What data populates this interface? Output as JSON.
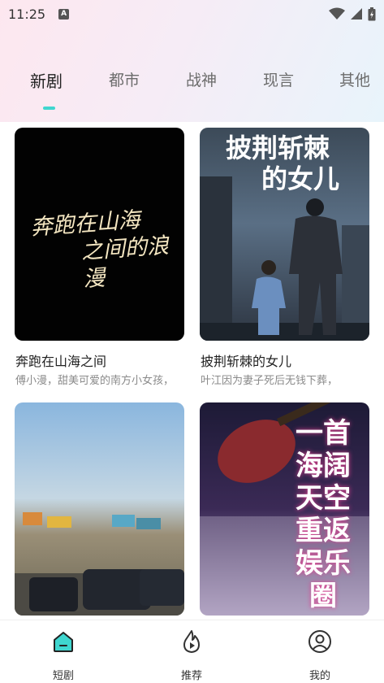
{
  "status_bar": {
    "time": "11:25",
    "notification_badge": "A",
    "icons": [
      "wifi-icon",
      "signal-icon",
      "battery-icon"
    ]
  },
  "tabs": [
    {
      "label": "新剧",
      "active": true
    },
    {
      "label": "都市",
      "active": false
    },
    {
      "label": "战神",
      "active": false
    },
    {
      "label": "现言",
      "active": false
    },
    {
      "label": "其他",
      "active": false
    }
  ],
  "cards": [
    {
      "title": "奔跑在山海之间",
      "desc": "傅小漫，甜美可爱的南方小女孩，",
      "poster_text": [
        "奔跑在山海",
        "之间的浪漫"
      ]
    },
    {
      "title": "披荆斩棘的女儿",
      "desc": "叶江因为妻子死后无钱下葬，",
      "poster_text": [
        "披荆斩棘",
        "的女儿"
      ]
    },
    {
      "title": "",
      "desc": "",
      "poster_text": []
    },
    {
      "title": "",
      "desc": "",
      "poster_text": [
        "一首海阔天空",
        "重返娱乐圈"
      ]
    }
  ],
  "bottom_nav": [
    {
      "label": "短剧",
      "icon": "home-icon",
      "active": true
    },
    {
      "label": "推荐",
      "icon": "flame-play-icon",
      "active": false
    },
    {
      "label": "我的",
      "icon": "profile-icon",
      "active": false
    }
  ],
  "colors": {
    "accent": "#3fd6cf",
    "tab_active": "#222222",
    "tab_inactive": "#6c6c6c"
  }
}
